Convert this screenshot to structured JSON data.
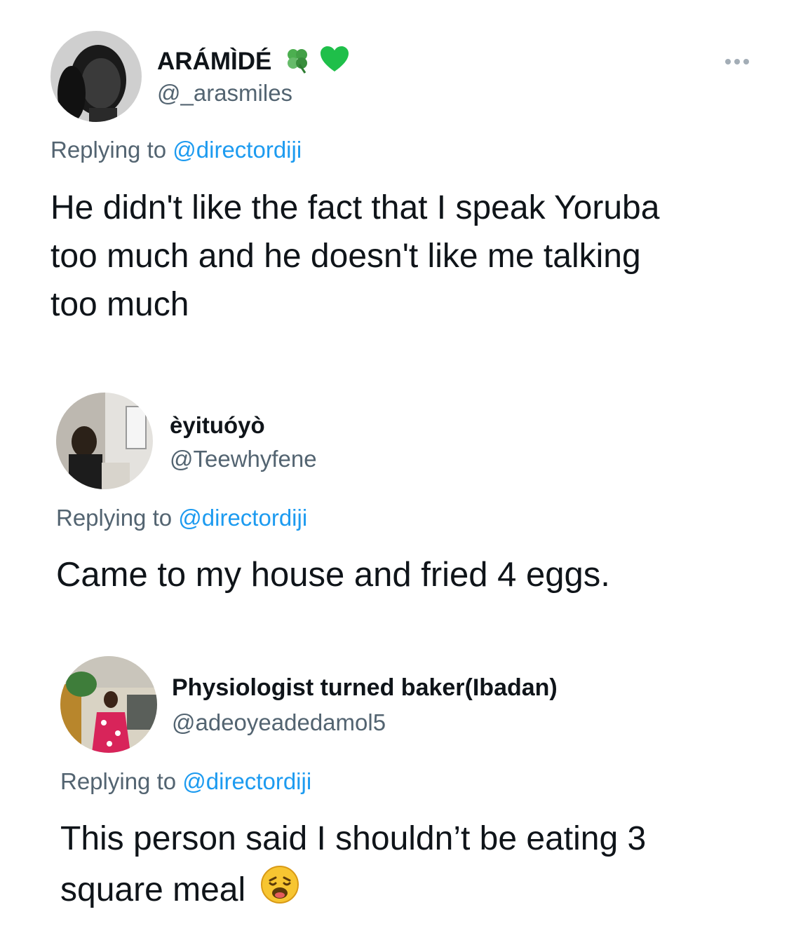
{
  "tweets": [
    {
      "display_name": "ARÁMÌDÉ",
      "badges": [
        "four-leaf-clover-icon",
        "green-heart-icon"
      ],
      "handle": "@_arasmiles",
      "reply_prefix": "Replying to",
      "reply_mention": "@directordiji",
      "text_lines": [
        "He didn't like the fact that I speak Yoruba",
        "too much and he doesn't like me talking",
        "too much"
      ]
    },
    {
      "display_name": "èyituóyò",
      "handle": "@Teewhyfene",
      "reply_prefix": "Replying to",
      "reply_mention": "@directordiji",
      "text_lines": [
        "Came to my house and fried 4 eggs."
      ]
    },
    {
      "display_name": "Physiologist turned baker(Ibadan)",
      "handle": "@adeoyeadedamol5",
      "reply_prefix": "Replying to",
      "reply_mention": "@directordiji",
      "text_lines": [
        "This person said I shouldn’t be eating 3",
        "square meal"
      ],
      "trailing_emoji": "weary-face-icon"
    }
  ],
  "colors": {
    "text": "#0f1419",
    "secondary": "#536471",
    "link": "#1d9bf0",
    "heart": "#1fbf4a",
    "clover": "#4caf50"
  },
  "more_menu_icon": "more-dots-icon"
}
